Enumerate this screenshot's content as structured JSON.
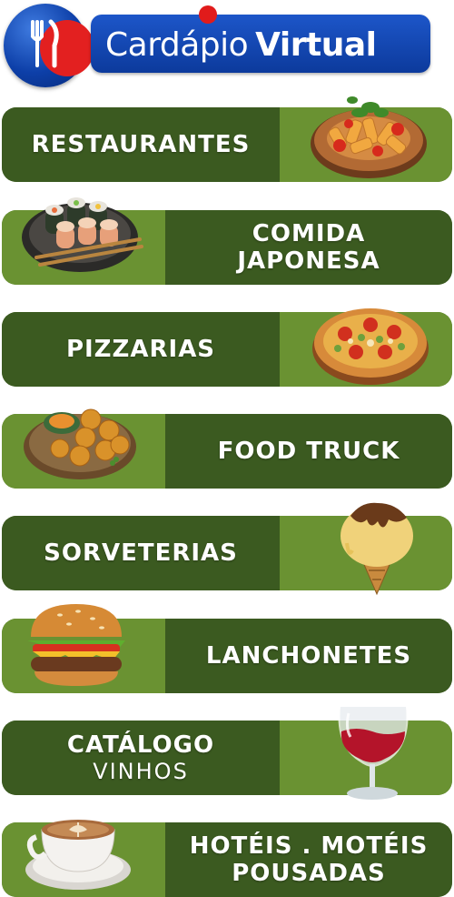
{
  "brand": {
    "part1": "Cardápio",
    "part2": "Virtual",
    "colors": {
      "blue": "#1d56c9",
      "red": "#e32020",
      "green": "#4e6e2d",
      "green_light": "#6a9232",
      "green_dark": "#3b5a20"
    },
    "icon": "fork-knife-icon"
  },
  "categories": [
    {
      "line1": "RESTAURANTES",
      "line2": "",
      "sub": "",
      "icon": "pasta-plate-icon"
    },
    {
      "line1": "COMIDA",
      "line2": "JAPONESA",
      "sub": "",
      "icon": "sushi-plate-icon"
    },
    {
      "line1": "PIZZARIAS",
      "line2": "",
      "sub": "",
      "icon": "pizza-icon"
    },
    {
      "line1": "FOOD TRUCK",
      "line2": "",
      "sub": "",
      "icon": "croquettes-plate-icon"
    },
    {
      "line1": "SORVETERIAS",
      "line2": "",
      "sub": "",
      "icon": "ice-cream-icon"
    },
    {
      "line1": "LANCHONETES",
      "line2": "",
      "sub": "",
      "icon": "burger-icon"
    },
    {
      "line1": "CATÁLOGO",
      "line2": "",
      "sub": "VINHOS",
      "icon": "wine-glass-icon"
    },
    {
      "line1": "HOTÉIS . MOTÉIS",
      "line2": "POUSADAS",
      "sub": "",
      "icon": "coffee-cup-icon"
    }
  ]
}
